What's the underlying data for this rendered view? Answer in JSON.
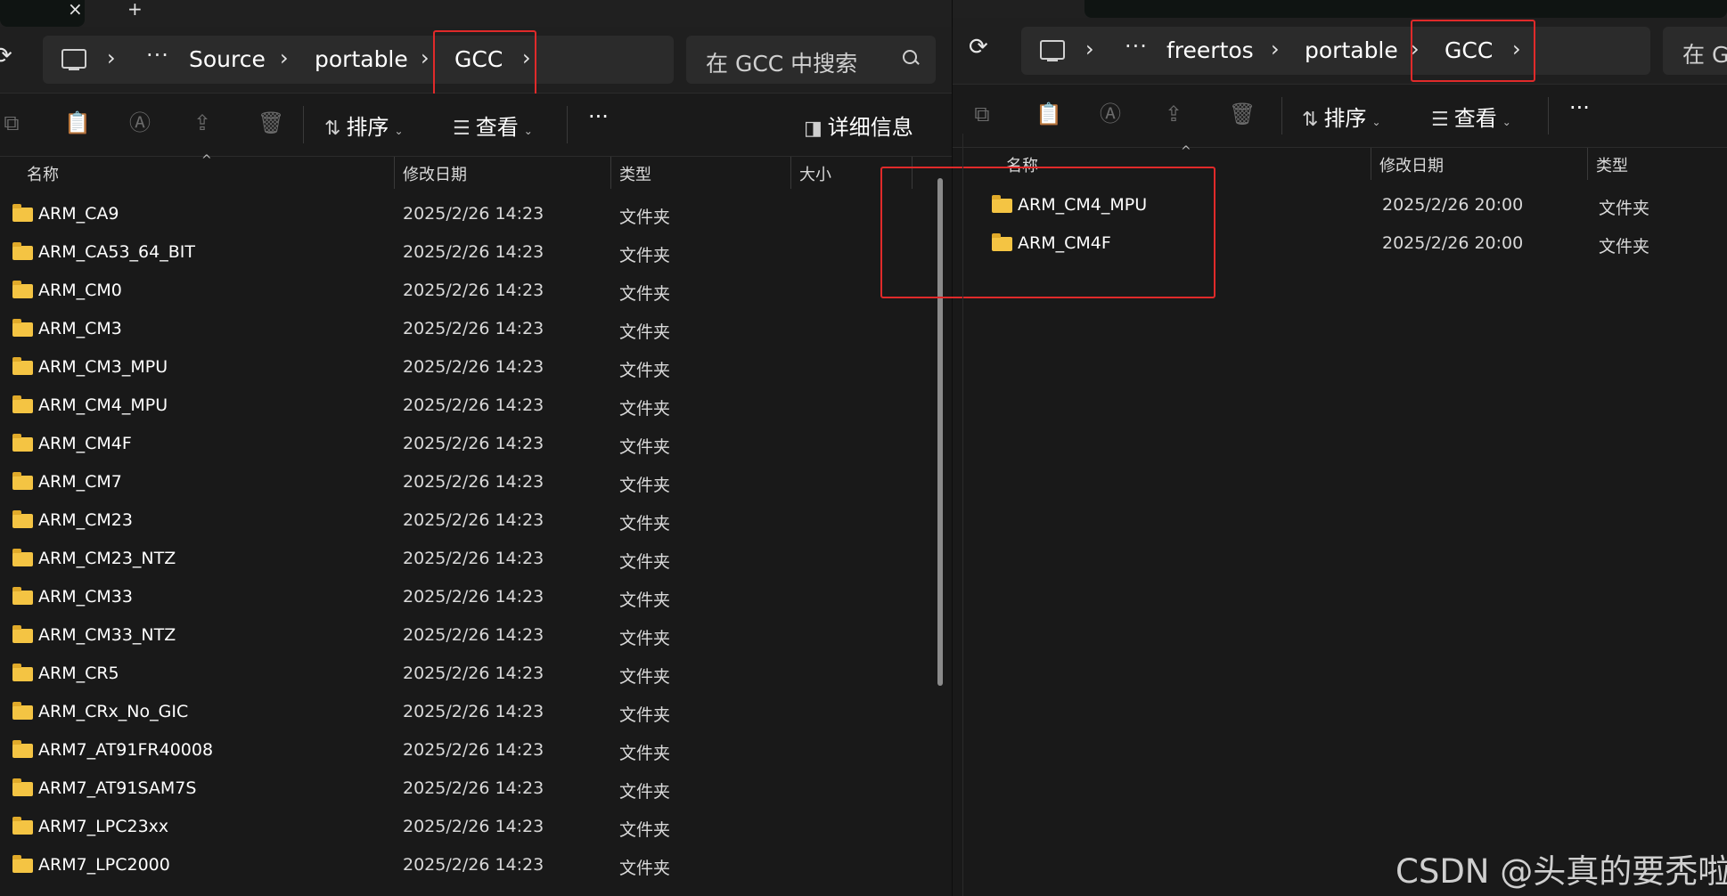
{
  "left": {
    "tab_close": "×",
    "tab_add": "+",
    "breadcrumb": [
      "Source",
      "portable",
      "GCC"
    ],
    "search_placeholder": "在 GCC 中搜索",
    "toolbar": {
      "sort": "排序",
      "view": "查看",
      "more": "···",
      "details": "详细信息"
    },
    "columns": {
      "name": "名称",
      "date": "修改日期",
      "type": "类型",
      "size": "大小"
    },
    "files": [
      {
        "name": "ARM_CA9",
        "date": "2025/2/26 14:23",
        "type": "文件夹"
      },
      {
        "name": "ARM_CA53_64_BIT",
        "date": "2025/2/26 14:23",
        "type": "文件夹"
      },
      {
        "name": "ARM_CM0",
        "date": "2025/2/26 14:23",
        "type": "文件夹"
      },
      {
        "name": "ARM_CM3",
        "date": "2025/2/26 14:23",
        "type": "文件夹"
      },
      {
        "name": "ARM_CM3_MPU",
        "date": "2025/2/26 14:23",
        "type": "文件夹"
      },
      {
        "name": "ARM_CM4_MPU",
        "date": "2025/2/26 14:23",
        "type": "文件夹"
      },
      {
        "name": "ARM_CM4F",
        "date": "2025/2/26 14:23",
        "type": "文件夹"
      },
      {
        "name": "ARM_CM7",
        "date": "2025/2/26 14:23",
        "type": "文件夹"
      },
      {
        "name": "ARM_CM23",
        "date": "2025/2/26 14:23",
        "type": "文件夹"
      },
      {
        "name": "ARM_CM23_NTZ",
        "date": "2025/2/26 14:23",
        "type": "文件夹"
      },
      {
        "name": "ARM_CM33",
        "date": "2025/2/26 14:23",
        "type": "文件夹"
      },
      {
        "name": "ARM_CM33_NTZ",
        "date": "2025/2/26 14:23",
        "type": "文件夹"
      },
      {
        "name": "ARM_CR5",
        "date": "2025/2/26 14:23",
        "type": "文件夹"
      },
      {
        "name": "ARM_CRx_No_GIC",
        "date": "2025/2/26 14:23",
        "type": "文件夹"
      },
      {
        "name": "ARM7_AT91FR40008",
        "date": "2025/2/26 14:23",
        "type": "文件夹"
      },
      {
        "name": "ARM7_AT91SAM7S",
        "date": "2025/2/26 14:23",
        "type": "文件夹"
      },
      {
        "name": "ARM7_LPC23xx",
        "date": "2025/2/26 14:23",
        "type": "文件夹"
      },
      {
        "name": "ARM7_LPC2000",
        "date": "2025/2/26 14:23",
        "type": "文件夹"
      }
    ]
  },
  "right": {
    "breadcrumb": [
      "freertos",
      "portable",
      "GCC"
    ],
    "search_placeholder": "在 G",
    "toolbar": {
      "sort": "排序",
      "view": "查看",
      "more": "···"
    },
    "columns": {
      "name": "名称",
      "date": "修改日期",
      "type": "类型"
    },
    "files": [
      {
        "name": "ARM_CM4_MPU",
        "date": "2025/2/26 20:00",
        "type": "文件夹"
      },
      {
        "name": "ARM_CM4F",
        "date": "2025/2/26 20:00",
        "type": "文件夹"
      }
    ]
  },
  "watermark": "CSDN @头真的要秃啦",
  "colors": {
    "highlight": "#e02a2a",
    "folder": "#f4c443",
    "background": "#191919"
  },
  "icons": [
    "refresh-icon",
    "pc-icon",
    "chevron-right-icon",
    "search-icon",
    "copy-icon",
    "paste-icon",
    "rename-icon",
    "share-icon",
    "delete-icon",
    "sort-icon",
    "view-icon",
    "details-pane-icon",
    "folder-icon"
  ]
}
